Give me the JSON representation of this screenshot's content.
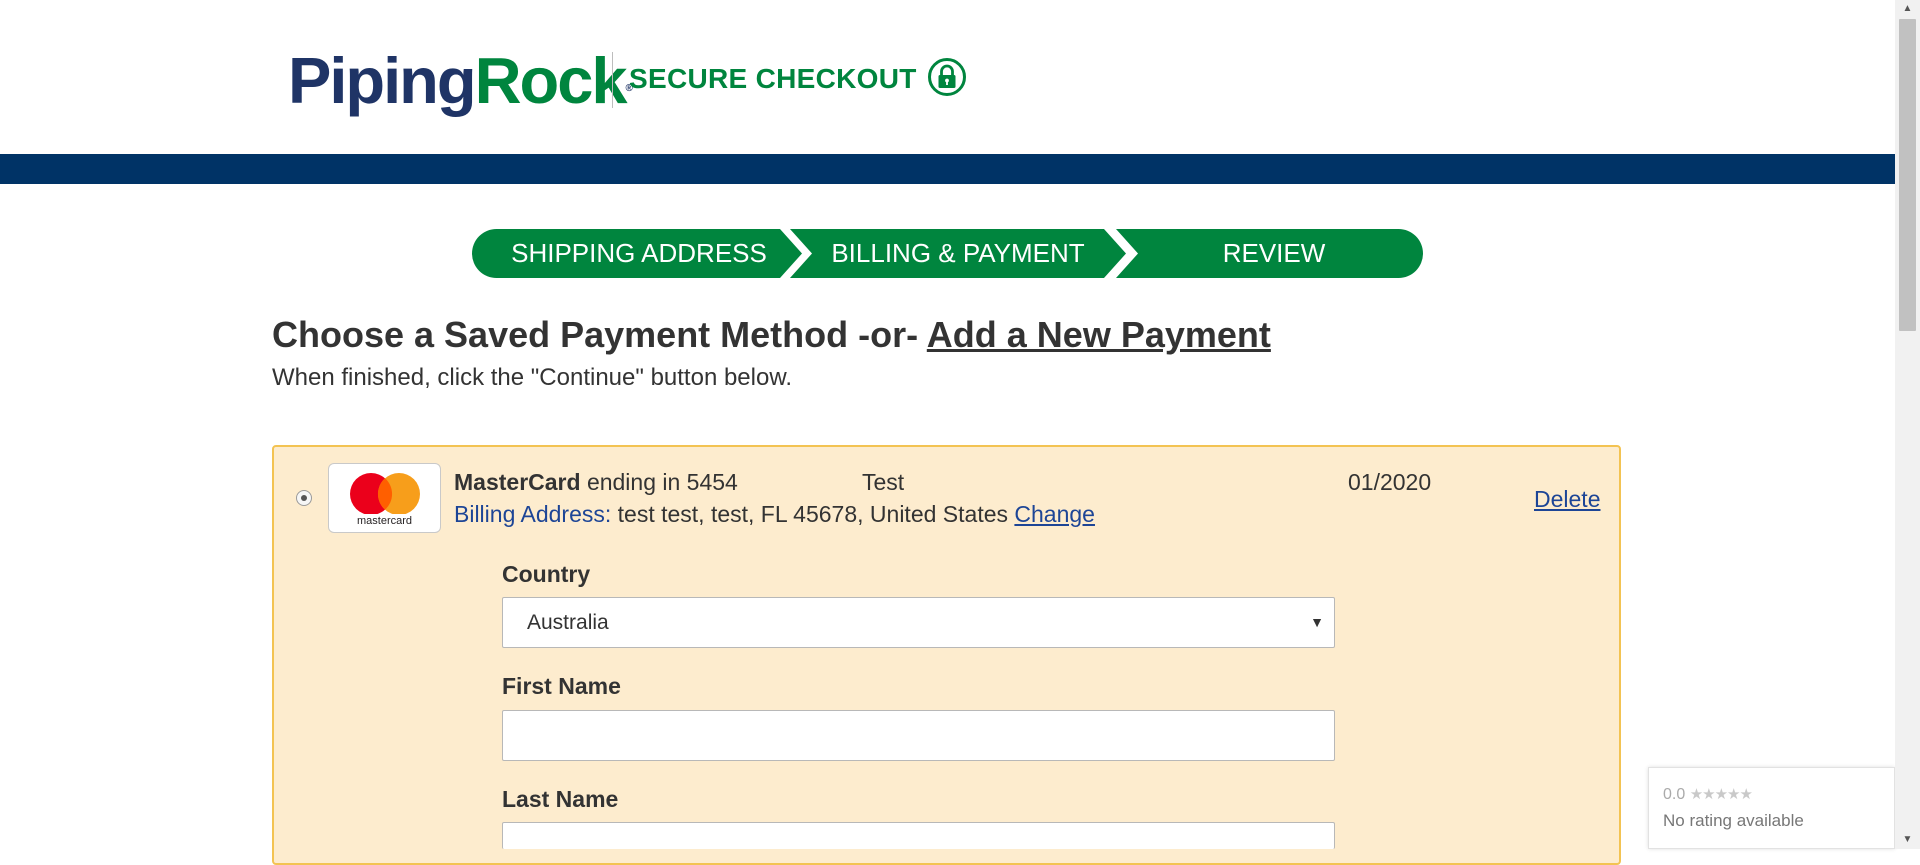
{
  "header": {
    "logo_part1": "Piping",
    "logo_part2": "Rock",
    "logo_reg": "®",
    "secure_title": "SECURE CHECKOUT",
    "lock_icon": "lock-icon"
  },
  "colors": {
    "brand_green": "#00853e",
    "brand_navy": "#1f3466",
    "nav_bar": "#003366",
    "panel_bg": "#fdecce",
    "panel_border": "#f3c352",
    "link_blue": "#1d4596"
  },
  "steps": [
    {
      "label": "SHIPPING ADDRESS"
    },
    {
      "label": "BILLING & PAYMENT"
    },
    {
      "label": "REVIEW"
    }
  ],
  "payment": {
    "title_prefix": "Choose a Saved Payment Method -or-",
    "add_new_link": "Add a New Payment",
    "subtitle": "When finished, click the \"Continue\" button below."
  },
  "saved_card": {
    "brand": "MasterCard",
    "ending_text": "ending in 5454",
    "holder": "Test",
    "expiry": "01/2020",
    "delete_label": "Delete",
    "billing_label": "Billing Address",
    "billing_colon": ":",
    "billing_address": "test test, test, FL 45678, United States",
    "change_label": "Change",
    "logo_text": "mastercard",
    "logo_icon": "mastercard-logo-icon",
    "selected": true
  },
  "form": {
    "country_label": "Country",
    "country_value": "Australia",
    "first_name_label": "First Name",
    "first_name_value": "",
    "last_name_label": "Last Name",
    "last_name_value": ""
  },
  "rating_badge": {
    "score": "0.0",
    "stars": "★★★★★",
    "text": "No rating available"
  }
}
